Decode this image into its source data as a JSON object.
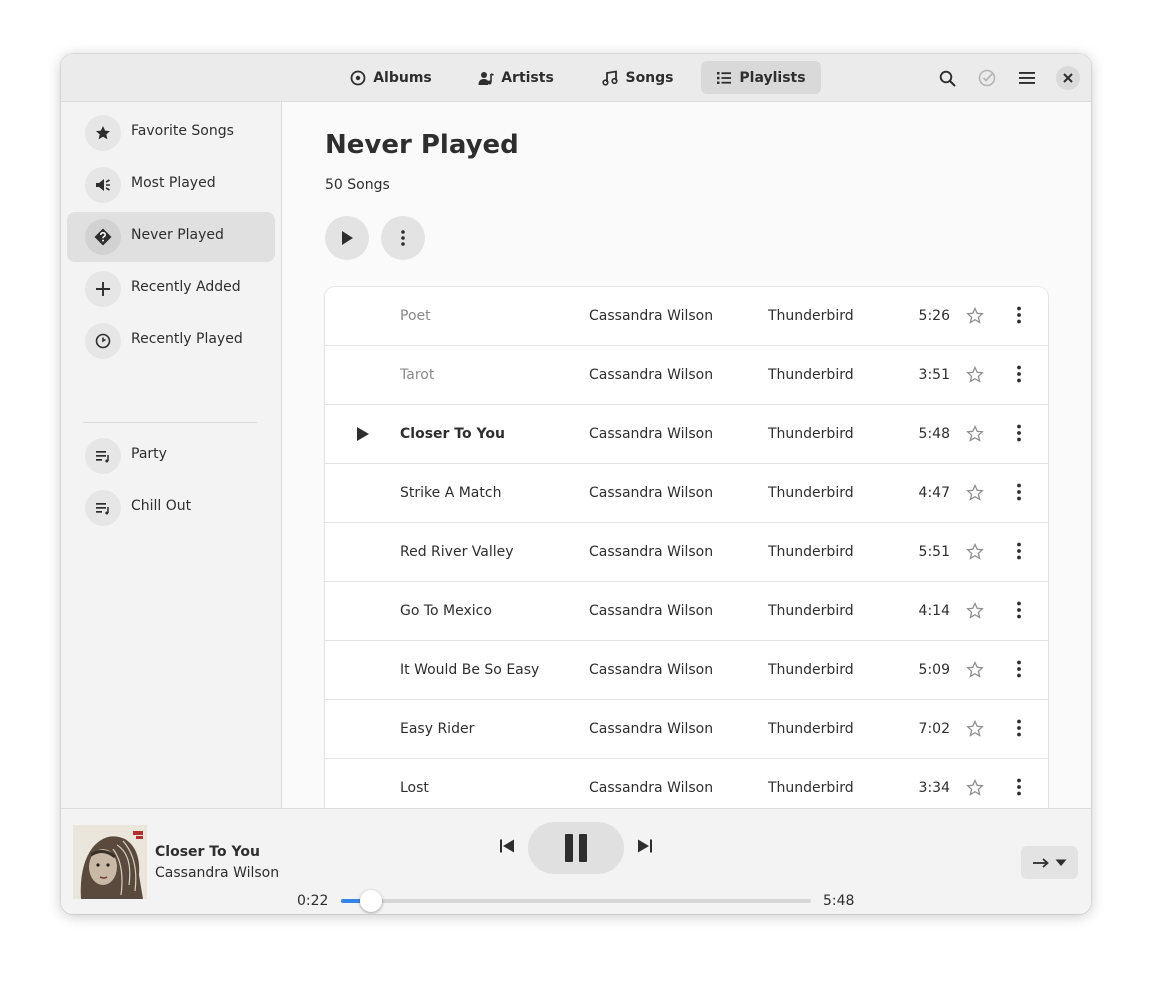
{
  "header": {
    "tabs": [
      {
        "label": "Albums",
        "icon": "disc-icon",
        "active": false
      },
      {
        "label": "Artists",
        "icon": "artist-icon",
        "active": false
      },
      {
        "label": "Songs",
        "icon": "music-note-icon",
        "active": false
      },
      {
        "label": "Playlists",
        "icon": "list-icon",
        "active": true
      }
    ],
    "buttons": [
      "search-icon",
      "select-check-icon",
      "menu-icon",
      "close-icon"
    ]
  },
  "sidebar": {
    "items": [
      {
        "label": "Favorite Songs",
        "icon": "star-icon"
      },
      {
        "label": "Most Played",
        "icon": "megaphone-icon"
      },
      {
        "label": "Never Played",
        "icon": "question-diamond-icon",
        "active": true
      },
      {
        "label": "Recently Added",
        "icon": "plus-icon"
      },
      {
        "label": "Recently Played",
        "icon": "clock-icon"
      },
      {
        "label": "Party",
        "icon": "playlist-icon"
      },
      {
        "label": "Chill Out",
        "icon": "playlist-icon"
      }
    ]
  },
  "playlist": {
    "title": "Never Played",
    "count": "50 Songs"
  },
  "songs": [
    {
      "title": "Poet",
      "artist": "Cassandra Wilson",
      "album": "Thunderbird",
      "duration": "5:26"
    },
    {
      "title": "Tarot",
      "artist": "Cassandra Wilson",
      "album": "Thunderbird",
      "duration": "3:51"
    },
    {
      "title": "Closer To You",
      "artist": "Cassandra Wilson",
      "album": "Thunderbird",
      "duration": "5:48"
    },
    {
      "title": "Strike A Match",
      "artist": "Cassandra Wilson",
      "album": "Thunderbird",
      "duration": "4:47"
    },
    {
      "title": "Red River Valley",
      "artist": "Cassandra Wilson",
      "album": "Thunderbird",
      "duration": "5:51"
    },
    {
      "title": "Go To Mexico",
      "artist": "Cassandra Wilson",
      "album": "Thunderbird",
      "duration": "4:14"
    },
    {
      "title": "It Would Be So Easy",
      "artist": "Cassandra Wilson",
      "album": "Thunderbird",
      "duration": "5:09"
    },
    {
      "title": "Easy Rider",
      "artist": "Cassandra Wilson",
      "album": "Thunderbird",
      "duration": "7:02"
    },
    {
      "title": "Lost",
      "artist": "Cassandra Wilson",
      "album": "Thunderbird",
      "duration": "3:34"
    }
  ],
  "player": {
    "title": "Closer To You",
    "artist": "Cassandra Wilson",
    "elapsed": "0:22",
    "total": "5:48",
    "progress_fraction": 0.063
  },
  "colors": {
    "accent": "#3584e4"
  }
}
